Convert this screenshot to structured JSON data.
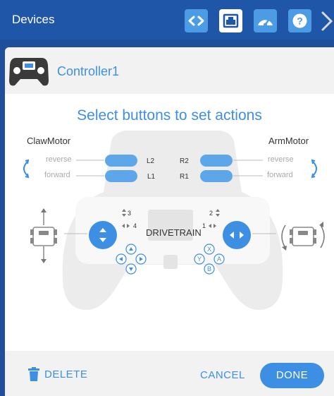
{
  "topbar": {
    "title": "Devices",
    "buttons": [
      "code-icon",
      "ethernet-port-icon",
      "gauge-icon",
      "help-icon"
    ],
    "active_button": "ethernet-port-icon"
  },
  "device": {
    "name": "Controller1",
    "icon": "gamepad-icon"
  },
  "main": {
    "heading": "Select buttons to set actions",
    "left_motor": "ClawMotor",
    "right_motor": "ArmMotor",
    "left_actions": [
      "reverse",
      "forward"
    ],
    "right_actions": [
      "reverse",
      "forward"
    ],
    "left_buttons": [
      "L2",
      "L1"
    ],
    "right_buttons": [
      "R2",
      "R1"
    ],
    "drivetrain_label": "DRIVETRAIN",
    "left_axes": [
      "3",
      "4"
    ],
    "right_axes": [
      "2",
      "1"
    ],
    "face_buttons": [
      "X",
      "Y",
      "A",
      "B"
    ]
  },
  "footer": {
    "delete_label": "DELETE",
    "cancel_label": "CANCEL",
    "done_label": "DONE"
  },
  "colors": {
    "topbar": "#1f56a8",
    "accent": "#3d8fe3",
    "button_fill": "#5ea6ea",
    "controller_ghost": "#ececec"
  }
}
